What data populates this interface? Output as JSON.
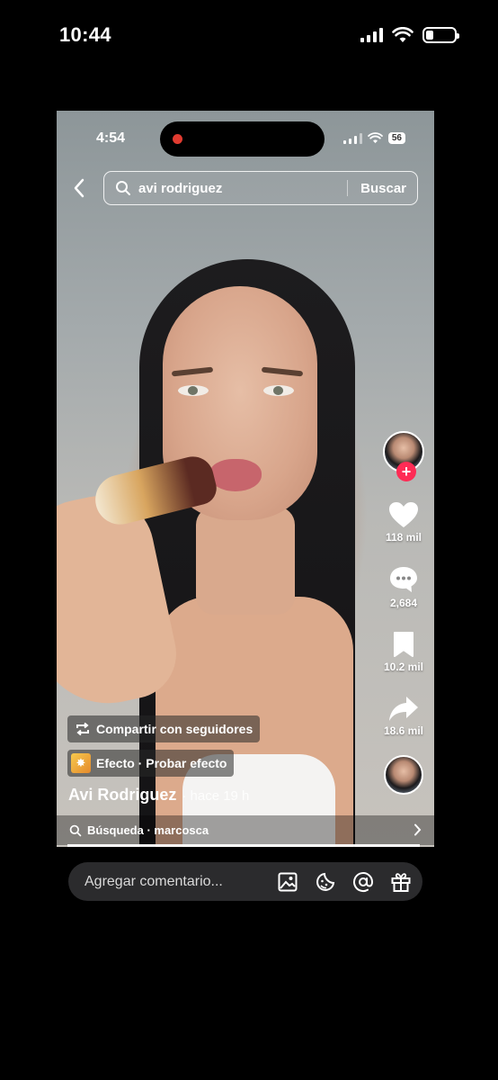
{
  "os_status": {
    "time": "10:44"
  },
  "inner_status": {
    "time": "4:54",
    "battery": "56"
  },
  "search": {
    "query": "avi rodriguez",
    "submit_label": "Buscar"
  },
  "rail": {
    "likes": "118 mil",
    "comments": "2,684",
    "saves": "10.2 mil",
    "shares": "18.6 mil"
  },
  "video": {
    "share_label": "Compartir con seguidores",
    "effect_label": "Efecto · Probar efecto",
    "author": "Avi Rodriguez",
    "time_ago": "· hace 19 h",
    "related_search": "Búsqueda · marcosca",
    "progress": 1.0
  },
  "comment": {
    "placeholder": "Agregar comentario..."
  },
  "colors": {
    "follow_plus": "#fe2c55",
    "comment_bar_bg": "#2b2b2d",
    "record_dot": "#e03b30"
  }
}
